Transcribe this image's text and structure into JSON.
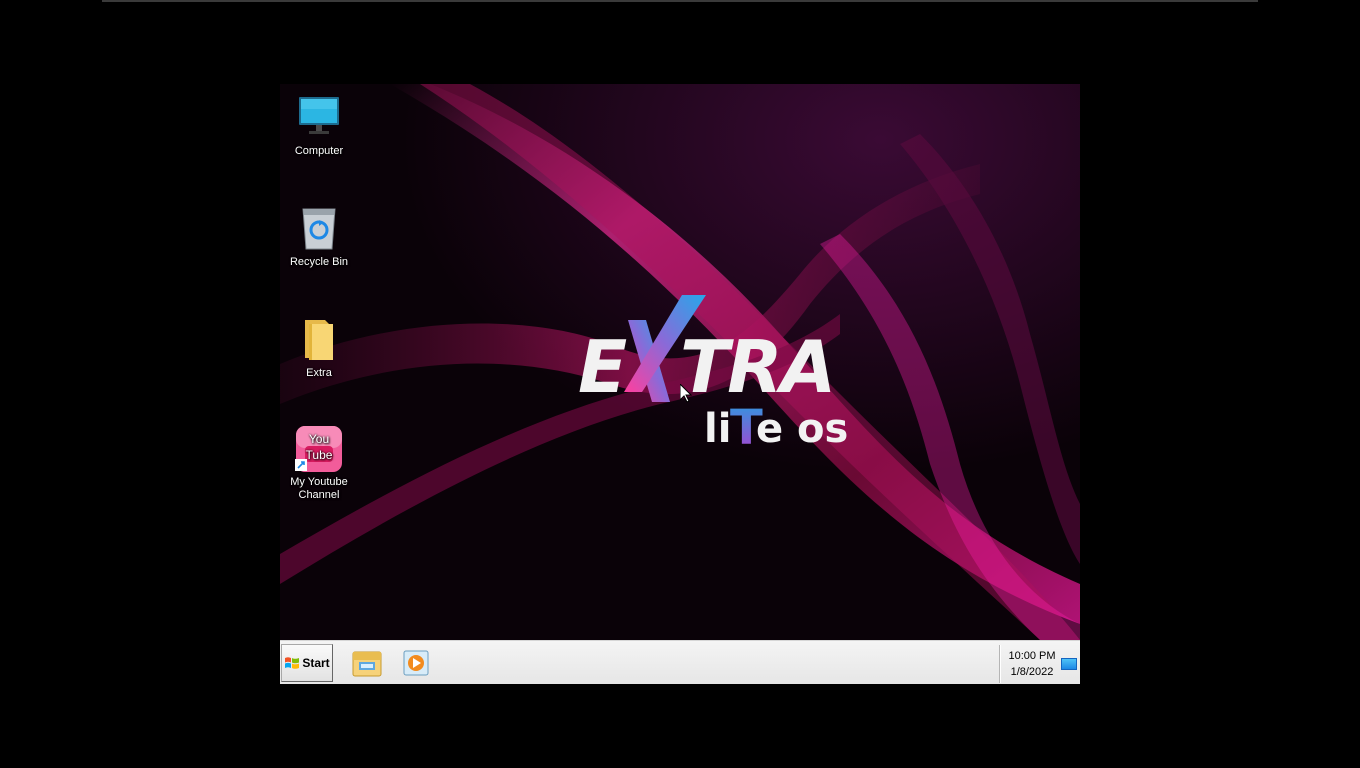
{
  "desktop": {
    "icons": [
      {
        "label": "Computer",
        "icon": "monitor-icon"
      },
      {
        "label": "Recycle Bin",
        "icon": "recycle-bin-icon"
      },
      {
        "label": "Extra",
        "icon": "folder-icon"
      },
      {
        "label": "My Youtube Channel",
        "icon": "youtube-shortcut-icon"
      }
    ],
    "logo": {
      "line1": "EXTRA",
      "line2": "liTe OS"
    }
  },
  "taskbar": {
    "start_label": "Start",
    "pinned": [
      {
        "name": "file-explorer",
        "icon": "file-explorer-icon"
      },
      {
        "name": "media-player",
        "icon": "media-player-icon"
      }
    ],
    "clock": {
      "time": "10:00 PM",
      "date": "1/8/2022"
    }
  },
  "colors": {
    "accent_magenta": "#e0157a",
    "accent_blue": "#2a9be0",
    "taskbar_bg": "#eeeeee"
  }
}
